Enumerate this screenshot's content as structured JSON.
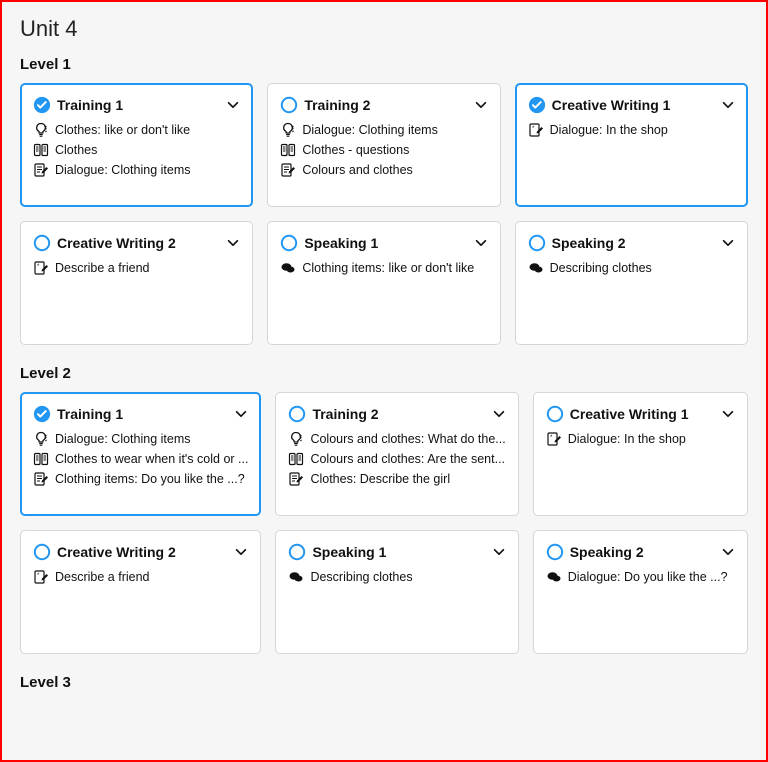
{
  "unit_title": "Unit 4",
  "levels": [
    {
      "title": "Level 1",
      "cards": [
        {
          "title": "Training 1",
          "selected": true,
          "checked": true,
          "activities": [
            {
              "icon": "idea",
              "text": "Clothes: like or don't like"
            },
            {
              "icon": "columns",
              "text": "Clothes"
            },
            {
              "icon": "write",
              "text": "Dialogue: Clothing items"
            }
          ]
        },
        {
          "title": "Training 2",
          "selected": false,
          "checked": false,
          "activities": [
            {
              "icon": "idea",
              "text": "Dialogue: Clothing items"
            },
            {
              "icon": "columns",
              "text": "Clothes - questions"
            },
            {
              "icon": "write",
              "text": "Colours and clothes"
            }
          ]
        },
        {
          "title": "Creative Writing 1",
          "selected": true,
          "checked": true,
          "activities": [
            {
              "icon": "writestar",
              "text": "Dialogue: In the shop"
            }
          ]
        },
        {
          "title": "Creative Writing 2",
          "selected": false,
          "checked": false,
          "activities": [
            {
              "icon": "writestar",
              "text": "Describe a friend"
            }
          ]
        },
        {
          "title": "Speaking 1",
          "selected": false,
          "checked": false,
          "activities": [
            {
              "icon": "speak",
              "text": "Clothing items: like or don't like"
            }
          ]
        },
        {
          "title": "Speaking 2",
          "selected": false,
          "checked": false,
          "activities": [
            {
              "icon": "speak",
              "text": "Describing clothes"
            }
          ]
        }
      ]
    },
    {
      "title": "Level 2",
      "cards": [
        {
          "title": "Training 1",
          "selected": true,
          "checked": true,
          "activities": [
            {
              "icon": "idea",
              "text": "Dialogue: Clothing items"
            },
            {
              "icon": "columns",
              "text": "Clothes to wear when it's cold or ..."
            },
            {
              "icon": "write",
              "text": "Clothing items: Do you like the ...?"
            }
          ]
        },
        {
          "title": "Training 2",
          "selected": false,
          "checked": false,
          "activities": [
            {
              "icon": "idea",
              "text": "Colours and clothes: What do the..."
            },
            {
              "icon": "columns",
              "text": "Colours and clothes: Are the sent..."
            },
            {
              "icon": "write",
              "text": "Clothes: Describe the girl"
            }
          ]
        },
        {
          "title": "Creative Writing 1",
          "selected": false,
          "checked": false,
          "activities": [
            {
              "icon": "writestar",
              "text": "Dialogue: In the shop"
            }
          ]
        },
        {
          "title": "Creative Writing 2",
          "selected": false,
          "checked": false,
          "activities": [
            {
              "icon": "writestar",
              "text": "Describe a friend"
            }
          ]
        },
        {
          "title": "Speaking 1",
          "selected": false,
          "checked": false,
          "activities": [
            {
              "icon": "speak",
              "text": "Describing clothes"
            }
          ]
        },
        {
          "title": "Speaking 2",
          "selected": false,
          "checked": false,
          "activities": [
            {
              "icon": "speak",
              "text": "Dialogue: Do you like the ...?"
            }
          ]
        }
      ]
    },
    {
      "title": "Level 3",
      "cards": []
    }
  ]
}
